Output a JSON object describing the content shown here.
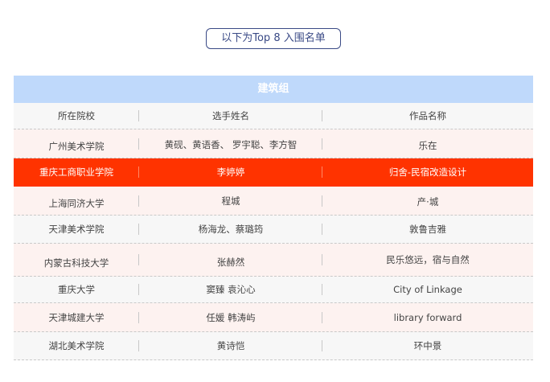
{
  "badge": "以下为Top 8 入围名单",
  "table": {
    "group_title": "建筑组",
    "headers": [
      "所在院校",
      "选手姓名",
      "作品名称"
    ],
    "rows": [
      {
        "school": "广州美术学院",
        "name": "黄砚、黄语香、  罗宇聪、李方智",
        "work": "乐在"
      },
      {
        "school": "重庆工商职业学院",
        "name": "李婷婷",
        "work": "归舍-民宿改造设计"
      },
      {
        "school": "上海同济大学",
        "name": "程城",
        "work": "产·城"
      },
      {
        "school": "天津美术学院",
        "name": "杨海龙、蔡璐筠",
        "work": "敦鲁吉雅"
      },
      {
        "school": "内蒙古科技大学",
        "name": "张赫然",
        "work": "民乐悠远，宿与自然"
      },
      {
        "school": "重庆大学",
        "name": "窦臻 袁沁心",
        "work": "City of Linkage"
      },
      {
        "school": "天津城建大学",
        "name": "任媛 韩涛屿",
        "work": "library forward"
      },
      {
        "school": "湖北美术学院",
        "name": "黄诗恺",
        "work": "环中景"
      }
    ]
  },
  "colors": {
    "header_bg": "#bfd9fb",
    "highlight_bg": "#ff3300",
    "badge_border": "#3a4a86"
  }
}
